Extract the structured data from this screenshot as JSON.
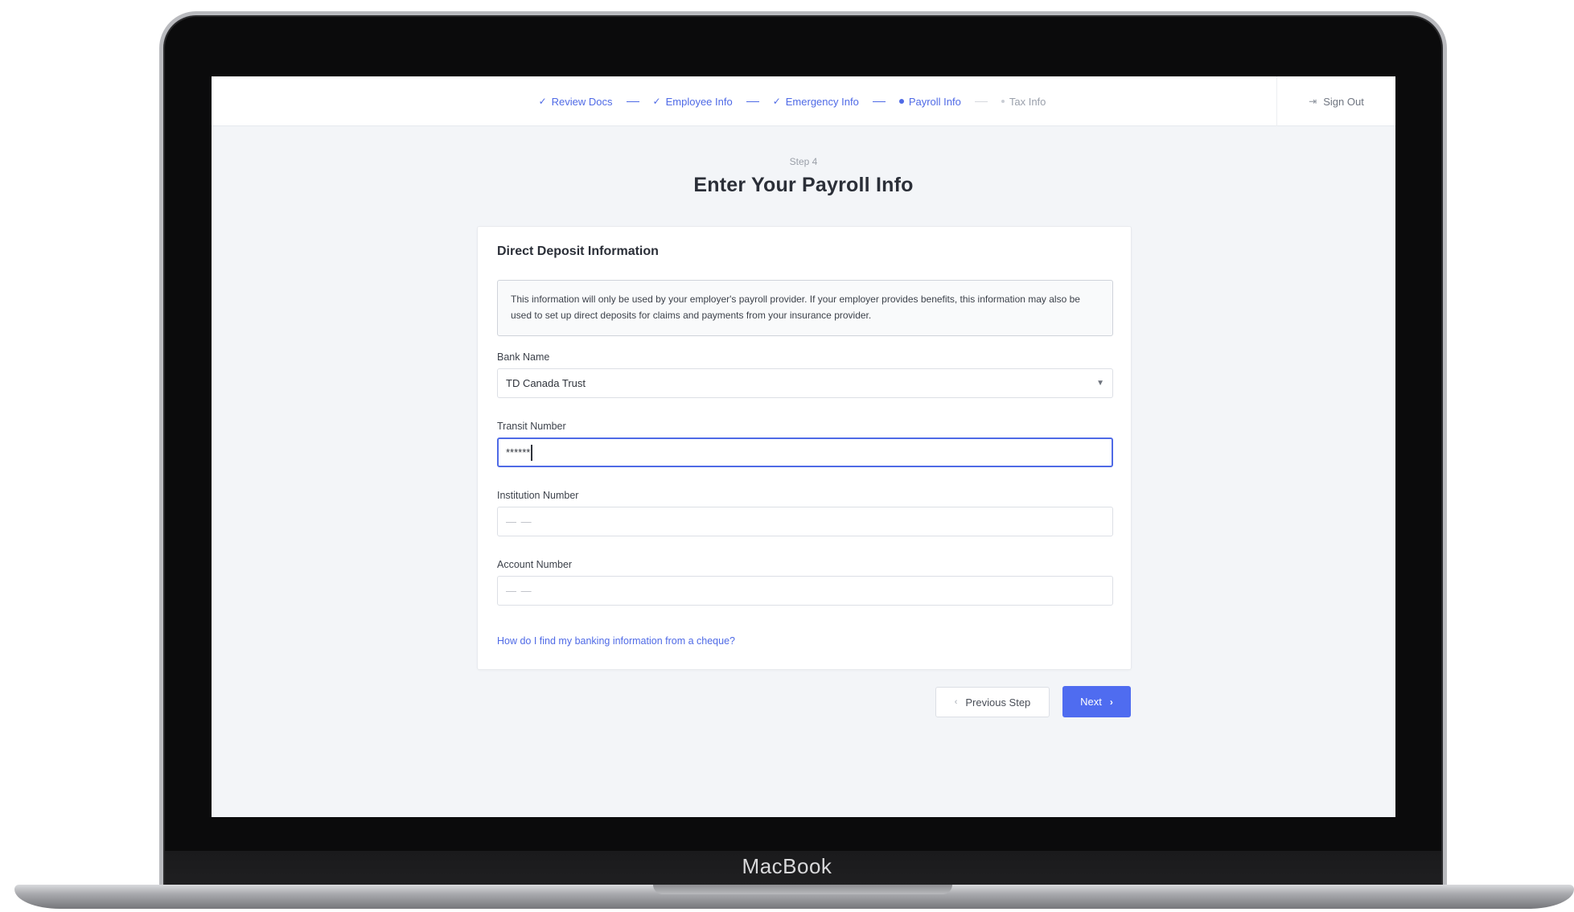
{
  "device": {
    "brand": "MacBook"
  },
  "stepper": {
    "steps": [
      {
        "label": "Review Docs",
        "state": "completed",
        "icon": "check-icon"
      },
      {
        "label": "Employee Info",
        "state": "completed",
        "icon": "check-icon"
      },
      {
        "label": "Emergency Info",
        "state": "completed",
        "icon": "check-icon"
      },
      {
        "label": "Payroll Info",
        "state": "current",
        "icon": "dot-icon"
      },
      {
        "label": "Tax Info",
        "state": "upcoming",
        "icon": "dot-icon"
      }
    ]
  },
  "header": {
    "sign_out_label": "Sign Out",
    "sign_out_icon": "sign-out-icon"
  },
  "page": {
    "step_label": "Step 4",
    "title": "Enter Your Payroll Info"
  },
  "card": {
    "title": "Direct Deposit Information",
    "notice": "This information will only be used by your employer's payroll provider. If your employer provides benefits, this information may also be used to set up direct deposits for claims and payments from your insurance provider.",
    "fields": {
      "bank_name": {
        "label": "Bank Name",
        "value": "TD Canada Trust"
      },
      "transit_number": {
        "label": "Transit Number",
        "value": "******"
      },
      "institution_number": {
        "label": "Institution Number",
        "placeholder": "— —"
      },
      "account_number": {
        "label": "Account Number",
        "placeholder": "— —"
      }
    },
    "help_link": "How do I find my banking information from a cheque?"
  },
  "actions": {
    "previous_label": "Previous Step",
    "next_label": "Next"
  },
  "colors": {
    "accent": "#4f6cf0",
    "background": "#f3f5f8"
  }
}
